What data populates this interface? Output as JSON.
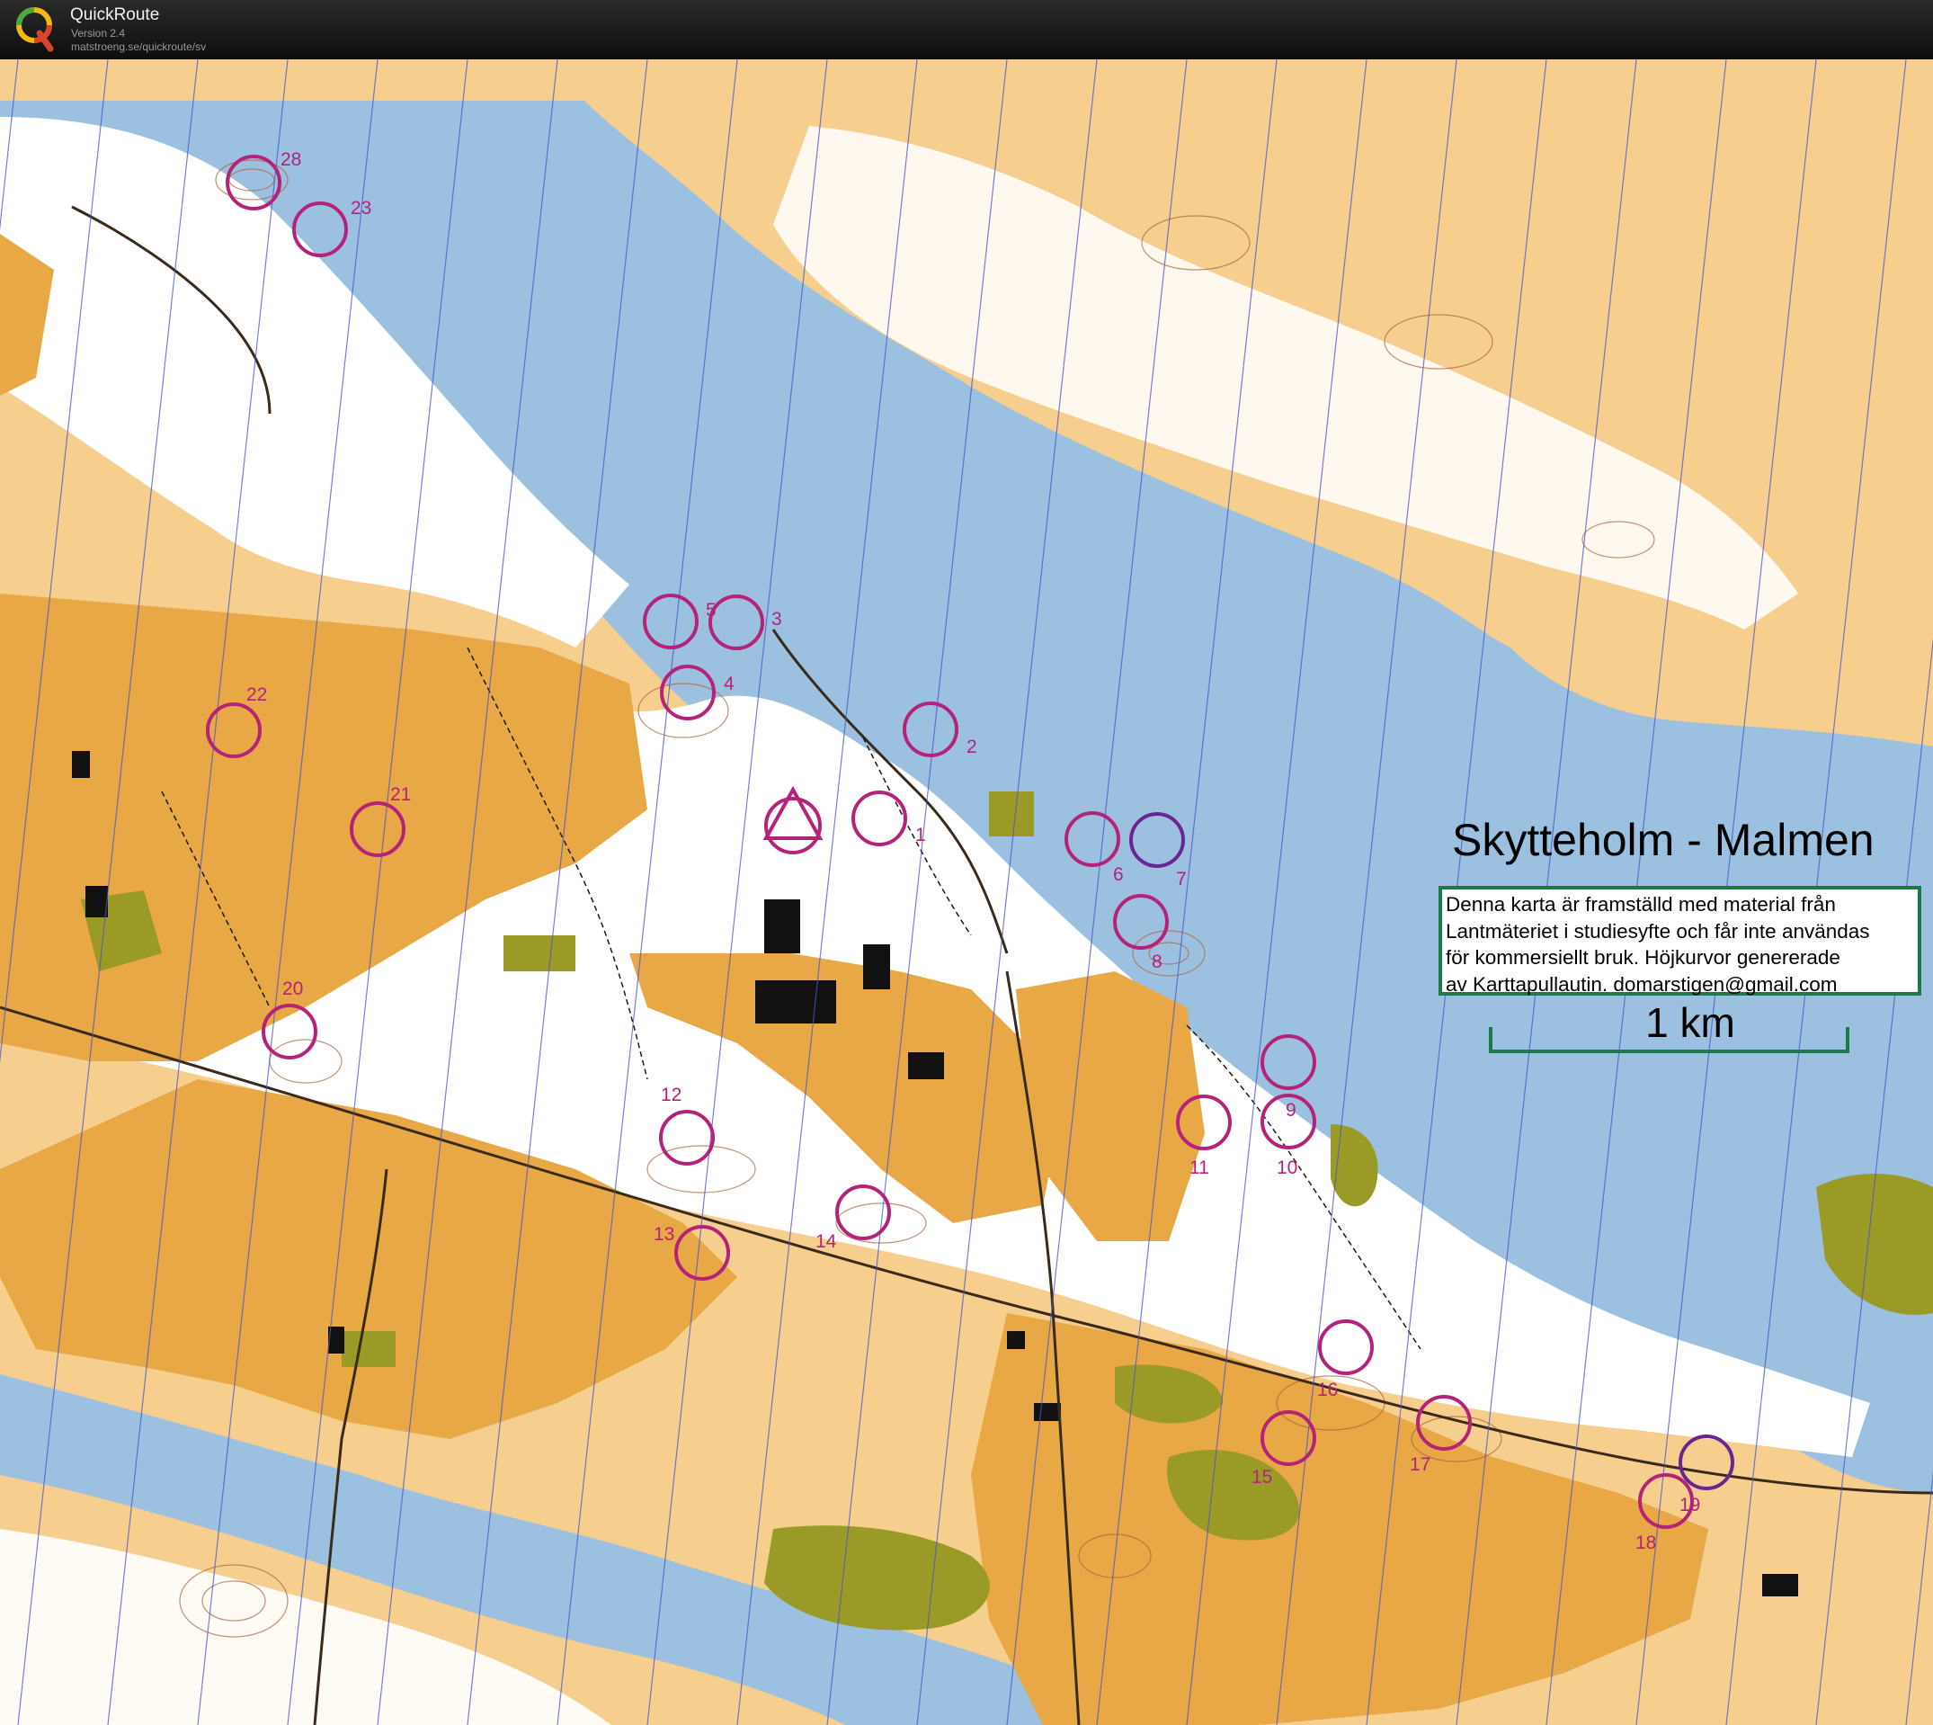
{
  "app": {
    "name": "QuickRoute",
    "version": "Version 2.4",
    "url": "matstroeng.se/quickroute/sv"
  },
  "map": {
    "title": "Skytteholm - Malmen",
    "info_lines": [
      "Denna karta är framställd med material från",
      "Lantmäteriet i studiesyfte och får inte användas",
      "för kommersiellt bruk. Höjkurvor genererade",
      "av Karttapullautin. domarstigen@gmail.com"
    ],
    "scale_label": "1 km"
  },
  "controls": {
    "labels": [
      "1",
      "2",
      "3",
      "4",
      "5",
      "6",
      "7",
      "8",
      "9",
      "10",
      "11",
      "12",
      "13",
      "14",
      "15",
      "16",
      "17",
      "18",
      "19",
      "20",
      "21",
      "22",
      "23",
      "28"
    ]
  },
  "colors": {
    "water": "#9cc0e0",
    "open_land": "#f6ce8e",
    "field": "#e7a845",
    "forest": "#ffffff",
    "green": "#9a9a26",
    "course": "#b4227a",
    "contour": "#a8643c",
    "frame": "#1d7a46"
  },
  "icons": [
    "quickroute-logo-icon"
  ]
}
